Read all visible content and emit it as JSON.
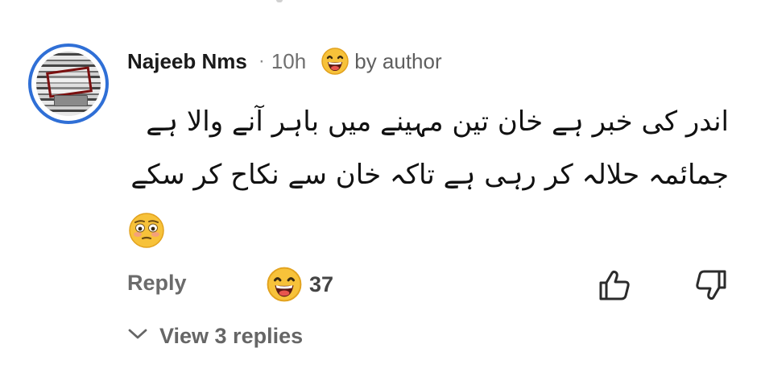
{
  "comment": {
    "author": "Najeeb Nms",
    "separator": "·",
    "time": "10h",
    "badge_icon": "laughing-face-emoji",
    "badge_text": "by author",
    "lines": [
      "اندر کی خبر ہے خان تین مہینے میں باہر آنے والا ہے",
      "جمائمہ حلالہ کر رہی ہے تاکہ خان سے نکاح کر سکے"
    ],
    "trailing_emoji": "flushed-face-emoji"
  },
  "actions": {
    "reply_label": "Reply",
    "reaction_icon": "laughing-face-emoji",
    "reaction_count": "37",
    "like_icon": "thumbs-up-icon",
    "dislike_icon": "thumbs-down-icon"
  },
  "replies": {
    "icon": "chevron-down-icon",
    "label": "View 3 replies"
  },
  "colors": {
    "avatar_ring": "#2f6fd6",
    "emoji_yellow": "#f7c23a",
    "secondary_text": "#6b6b6b"
  }
}
